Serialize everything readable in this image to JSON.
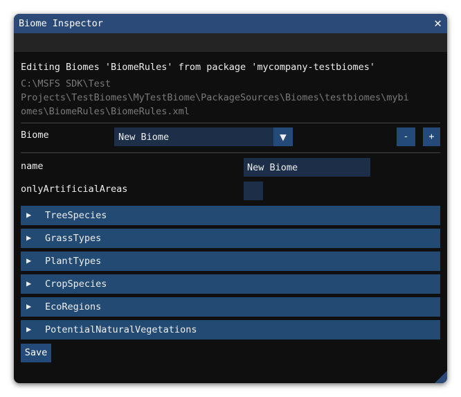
{
  "window": {
    "title": "Biome Inspector"
  },
  "info": {
    "editing": "Editing Biomes 'BiomeRules' from package 'mycompany-testbiomes'",
    "path_lines": [
      "C:\\MSFS SDK\\Test",
      "Projects\\TestBiomes\\MyTestBiome\\PackageSources\\Biomes\\testbiomes\\mybi",
      "omes\\BiomeRules\\BiomeRules.xml"
    ]
  },
  "biome": {
    "label": "Biome",
    "selected": "New Biome",
    "remove_label": "-",
    "add_label": "+"
  },
  "props": {
    "name_label": "name",
    "name_value": "New Biome",
    "only_label": "onlyArtificialAreas"
  },
  "sections": [
    "TreeSpecies",
    "GrassTypes",
    "PlantTypes",
    "CropSpecies",
    "EcoRegions",
    "PotentialNaturalVegetations"
  ],
  "save_label": "Save"
}
